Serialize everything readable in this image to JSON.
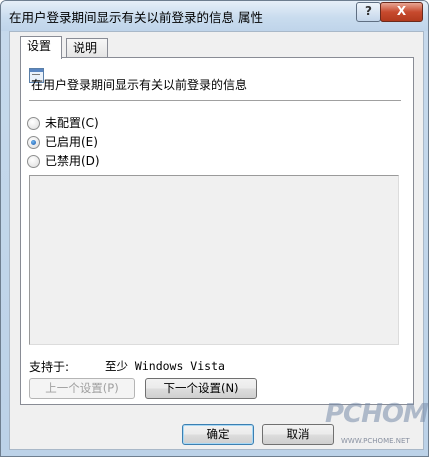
{
  "window": {
    "title": "在用户登录期间显示有关以前登录的信息 属性",
    "help_symbol": "?",
    "close_symbol": "X"
  },
  "tabs": [
    {
      "label": "设置",
      "selected": true
    },
    {
      "label": "说明",
      "selected": false
    }
  ],
  "policy": {
    "name": "在用户登录期间显示有关以前登录的信息",
    "icon": "policy-setting-icon"
  },
  "options": [
    {
      "label": "未配置(C)",
      "checked": false
    },
    {
      "label": "已启用(E)",
      "checked": true
    },
    {
      "label": "已禁用(D)",
      "checked": false
    }
  ],
  "supported": {
    "label": "支持于:",
    "value": "至少 Windows Vista"
  },
  "buttons": {
    "prev": "上一个设置(P)",
    "next": "下一个设置(N)",
    "ok": "确定",
    "cancel": "取消"
  },
  "watermark": {
    "brand": "PCHOME",
    "url": "WWW.PCHOME.NET"
  }
}
